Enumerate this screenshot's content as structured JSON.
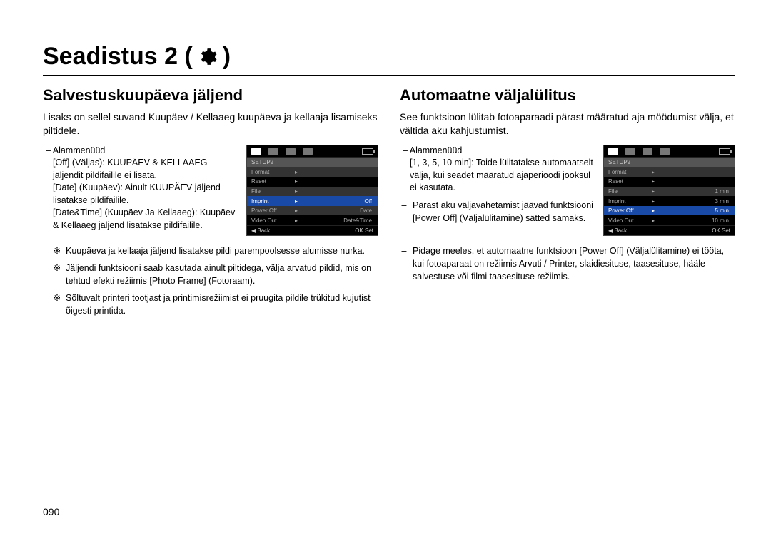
{
  "title": "Seadistus 2 (",
  "title_suffix": ")",
  "page_number": "090",
  "left": {
    "heading": "Salvestuskuupäeva jäljend",
    "intro": "Lisaks on sellel suvand Kuupäev / Kellaaeg kuupäeva ja kellaaja lisamiseks piltidele.",
    "submenus_label": "– Alammenüüd",
    "line_off": "[Off] (Väljas): KUUPÄEV & KELLAAEG jäljendit pildifailile ei lisata.",
    "line_date": "[Date] (Kuupäev): Ainult KUUPÄEV jäljend lisatakse pildifailile.",
    "line_dt": "[Date&Time] (Kuupäev Ja Kellaaeg): Kuupäev & Kellaaeg jäljend lisatakse pildifailile.",
    "note1": "Kuupäeva ja kellaaja jäljend lisatakse pildi parempoolsesse alumisse nurka.",
    "note2": "Jäljendi funktsiooni saab kasutada ainult piltidega, välja arvatud pildid, mis on tehtud efekti režiimis [Photo Frame] (Fotoraam).",
    "note3": "Sõltuvalt printeri tootjast ja printimisrežiimist ei pruugita pildile trükitud kujutist õigesti printida.",
    "lcd": {
      "tab": "SETUP2",
      "rows": [
        {
          "label": "Format",
          "val": ""
        },
        {
          "label": "Reset",
          "val": ""
        },
        {
          "label": "File",
          "val": ""
        },
        {
          "label": "Imprint",
          "val": "Off",
          "sel": true
        },
        {
          "label": "Power Off",
          "val": "Date"
        },
        {
          "label": "Video Out",
          "val": "Date&Time"
        }
      ],
      "back": "Back",
      "set": "Set"
    }
  },
  "right": {
    "heading": "Automaatne väljalülitus",
    "intro": "See funktsioon lülitab fotoaparaadi pärast määratud aja möödumist välja, et vältida aku kahjustumist.",
    "submenus_label": "– Alammenüüd",
    "line_opts": "[1, 3, 5, 10 min]: Toide lülitatakse automaatselt välja, kui seadet määratud ajaperioodi jooksul ei kasutata.",
    "bullet1": "Pärast aku väljavahetamist jäävad funktsiooni [Power Off] (Väljalülitamine) sätted samaks.",
    "bullet2": "Pidage meeles, et automaatne funktsioon [Power Off] (Väljalülitamine) ei tööta, kui fotoaparaat on režiimis Arvuti / Printer, slaidiesituse, taasesituse, hääle salvestuse või filmi taasesituse režiimis.",
    "lcd": {
      "tab": "SETUP2",
      "rows": [
        {
          "label": "Format",
          "val": ""
        },
        {
          "label": "Reset",
          "val": ""
        },
        {
          "label": "File",
          "val": "1 min"
        },
        {
          "label": "Imprint",
          "val": "3 min"
        },
        {
          "label": "Power Off",
          "val": "5 min",
          "sel": true
        },
        {
          "label": "Video Out",
          "val": "10 min"
        }
      ],
      "back": "Back",
      "set": "Set"
    }
  }
}
